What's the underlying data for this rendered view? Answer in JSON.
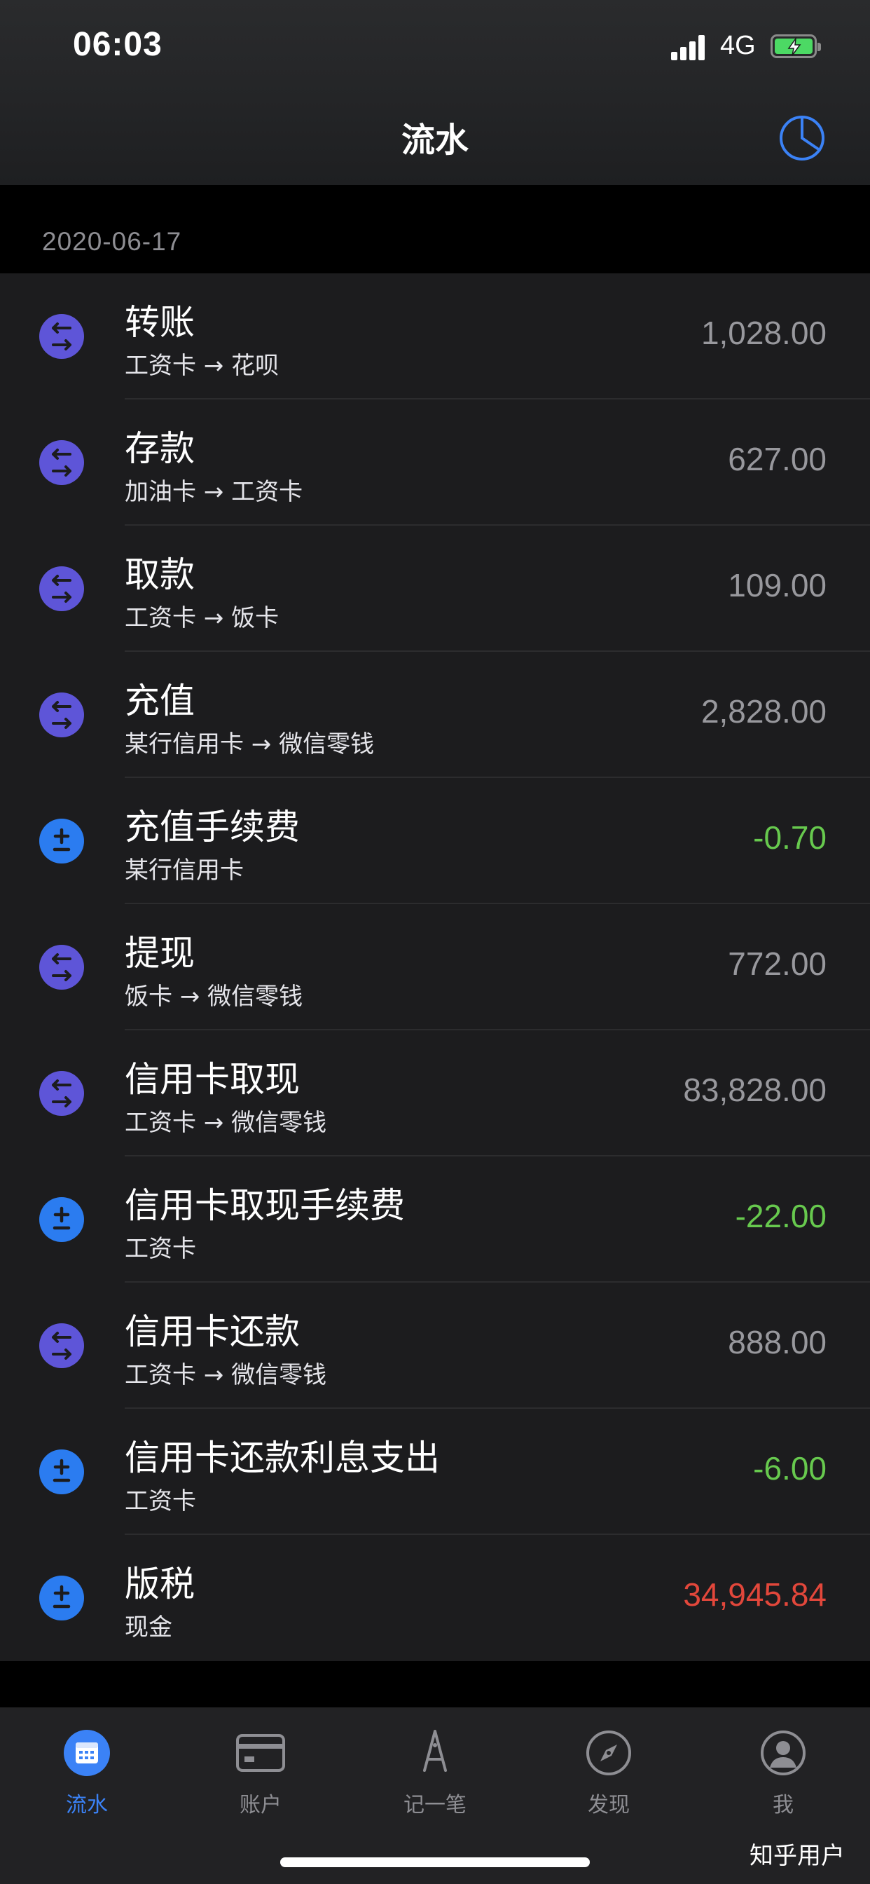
{
  "status_bar": {
    "time": "06:03",
    "network": "4G"
  },
  "nav": {
    "title": "流水",
    "chart_icon": "pie-chart-icon"
  },
  "section": {
    "date": "2020-06-17"
  },
  "colors": {
    "transfer_icon": "#5e55d8",
    "adjust_icon": "#2b7cf0",
    "positive": "#67c94e",
    "negative": "#e2473b",
    "active_tab": "#3b82f6"
  },
  "transactions": [
    {
      "type": "transfer",
      "title": "转账",
      "subtitle": "工资卡 → 花呗",
      "amount": "1,028.00",
      "tone": "neutral"
    },
    {
      "type": "transfer",
      "title": "存款",
      "subtitle": "加油卡 → 工资卡",
      "amount": "627.00",
      "tone": "neutral"
    },
    {
      "type": "transfer",
      "title": "取款",
      "subtitle": "工资卡 → 饭卡",
      "amount": "109.00",
      "tone": "neutral"
    },
    {
      "type": "transfer",
      "title": "充值",
      "subtitle": "某行信用卡 → 微信零钱",
      "amount": "2,828.00",
      "tone": "neutral"
    },
    {
      "type": "adjust",
      "title": "充值手续费",
      "subtitle": "某行信用卡",
      "amount": "-0.70",
      "tone": "green"
    },
    {
      "type": "transfer",
      "title": "提现",
      "subtitle": "饭卡 → 微信零钱",
      "amount": "772.00",
      "tone": "neutral"
    },
    {
      "type": "transfer",
      "title": "信用卡取现",
      "subtitle": "工资卡 → 微信零钱",
      "amount": "83,828.00",
      "tone": "neutral"
    },
    {
      "type": "adjust",
      "title": "信用卡取现手续费",
      "subtitle": "工资卡",
      "amount": "-22.00",
      "tone": "green"
    },
    {
      "type": "transfer",
      "title": "信用卡还款",
      "subtitle": "工资卡 → 微信零钱",
      "amount": "888.00",
      "tone": "neutral"
    },
    {
      "type": "adjust",
      "title": "信用卡还款利息支出",
      "subtitle": "工资卡",
      "amount": "-6.00",
      "tone": "green"
    },
    {
      "type": "adjust",
      "title": "版税",
      "subtitle": "现金",
      "amount": "34,945.84",
      "tone": "red"
    }
  ],
  "tabs": [
    {
      "label": "流水",
      "icon": "calendar-icon",
      "active": true
    },
    {
      "label": "账户",
      "icon": "card-icon",
      "active": false
    },
    {
      "label": "记一笔",
      "icon": "pen-nib-icon",
      "active": false
    },
    {
      "label": "发现",
      "icon": "compass-icon",
      "active": false
    },
    {
      "label": "我",
      "icon": "user-icon",
      "active": false
    }
  ],
  "watermark": "知乎用户"
}
